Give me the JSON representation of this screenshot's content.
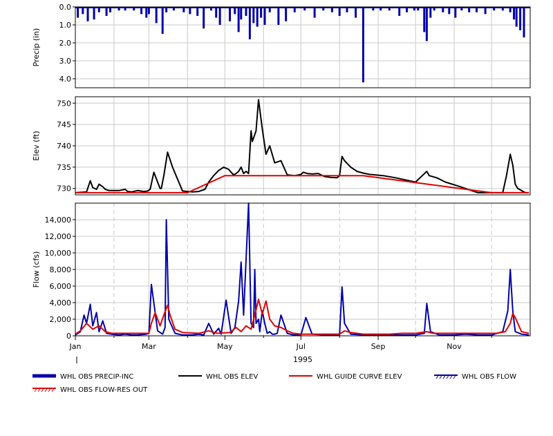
{
  "chart_data": [
    {
      "type": "bar",
      "ylabel": "Precip (in)",
      "ylim": [
        0,
        4.5
      ],
      "inverted": true,
      "yticks": [
        "0.0",
        "1.0",
        "2.0",
        "3.0",
        "4.0"
      ],
      "series": [
        {
          "name": "WHL OBS PRECIP-INC",
          "color": "#0000a8",
          "x": [
            "Jan 3",
            "Jan 7",
            "Jan 11",
            "Jan 16",
            "Jan 20",
            "Jan 26",
            "Jan 29",
            "Feb 5",
            "Feb 10",
            "Feb 17",
            "Feb 23",
            "Feb 27",
            "Mar 1",
            "Mar 7",
            "Mar 12",
            "Mar 15",
            "Mar 21",
            "Mar 29",
            "Apr 3",
            "Apr 9",
            "Apr 14",
            "Apr 20",
            "Apr 24",
            "Apr 27",
            "May 5",
            "May 9",
            "May 12",
            "May 14",
            "May 18",
            "May 21",
            "May 24",
            "May 27",
            "May 30",
            "Jun 2",
            "Jun 6",
            "Jun 13",
            "Jun 19",
            "Jun 26",
            "Jul 4",
            "Jul 12",
            "Jul 19",
            "Jul 26",
            "Aug 1",
            "Aug 7",
            "Aug 14",
            "Aug 20",
            "Aug 28",
            "Sep 3",
            "Sep 10",
            "Sep 18",
            "Sep 24",
            "Sep 30",
            "Oct 3",
            "Oct 8",
            "Oct 10",
            "Oct 13",
            "Oct 16",
            "Oct 23",
            "Oct 28",
            "Nov 2",
            "Nov 7",
            "Nov 13",
            "Nov 19",
            "Nov 26",
            "Dec 3",
            "Dec 10",
            "Dec 16",
            "Dec 19",
            "Dec 21",
            "Dec 24",
            "Dec 27"
          ],
          "values": [
            0.6,
            0.4,
            0.8,
            0.7,
            0.3,
            0.5,
            0.3,
            0.2,
            0.2,
            0.2,
            0.4,
            0.6,
            0.4,
            0.9,
            1.5,
            0.3,
            0.2,
            0.3,
            0.4,
            0.5,
            1.2,
            0.2,
            0.6,
            1.0,
            0.8,
            0.4,
            1.4,
            0.7,
            0.5,
            1.8,
            0.9,
            1.1,
            0.6,
            1.0,
            0.3,
            1.0,
            0.8,
            0.3,
            0.2,
            0.6,
            0.2,
            0.3,
            0.5,
            0.3,
            0.6,
            4.2,
            0.2,
            0.2,
            0.2,
            0.5,
            0.3,
            0.2,
            0.2,
            1.4,
            1.9,
            0.6,
            0.2,
            0.3,
            0.4,
            0.6,
            0.2,
            0.3,
            0.3,
            0.4,
            0.2,
            0.2,
            0.3,
            0.7,
            1.1,
            1.3,
            1.7
          ]
        }
      ]
    },
    {
      "type": "line",
      "ylabel": "Elev (ft)",
      "ylim": [
        728.5,
        751.5
      ],
      "yticks": [
        "730",
        "735",
        "740",
        "745",
        "750"
      ],
      "series": [
        {
          "name": "WHL OBS ELEV",
          "color": "#000000",
          "x": [
            "Jan 1",
            "Jan 10",
            "Jan 13",
            "Jan 15",
            "Jan 18",
            "Jan 20",
            "Jan 23",
            "Jan 25",
            "Jan 28",
            "Feb 5",
            "Feb 10",
            "Feb 12",
            "Feb 15",
            "Feb 20",
            "Feb 25",
            "Feb 28",
            "Mar 2",
            "Mar 5",
            "Mar 8",
            "Mar 10",
            "Mar 11",
            "Mar 13",
            "Mar 16",
            "Mar 20",
            "Mar 28",
            "Apr 5",
            "Apr 10",
            "Apr 15",
            "Apr 18",
            "Apr 22",
            "Apr 26",
            "Apr 30",
            "May 4",
            "May 6",
            "May 8",
            "May 10",
            "May 12",
            "May 14",
            "May 16",
            "May 18",
            "May 20",
            "May 22",
            "May 23",
            "May 26",
            "May 28",
            "May 31",
            "Jun 3",
            "Jun 6",
            "Jun 10",
            "Jun 15",
            "Jun 20",
            "Jun 26",
            "Jul 1",
            "Jul 3",
            "Jul 6",
            "Jul 10",
            "Jul 15",
            "Jul 20",
            "Jul 25",
            "Jul 30",
            "Aug 1",
            "Aug 3",
            "Aug 5",
            "Aug 10",
            "Aug 15",
            "Aug 20",
            "Aug 25",
            "Sep 5",
            "Sep 15",
            "Oct 1",
            "Oct 10",
            "Oct 12",
            "Oct 18",
            "Oct 25",
            "Nov 5",
            "Nov 15",
            "Nov 20",
            "Dec 1",
            "Dec 10",
            "Dec 13",
            "Dec 16",
            "Dec 18",
            "Dec 20",
            "Dec 22",
            "Dec 25",
            "Dec 28",
            "Dec 31"
          ],
          "values": [
            729,
            729.2,
            731.8,
            730.2,
            729.8,
            731.0,
            730.4,
            729.8,
            729.5,
            729.5,
            729.8,
            729.3,
            729.2,
            729.5,
            729.3,
            729.4,
            729.8,
            733.8,
            731.5,
            730.0,
            730.0,
            733.0,
            738.5,
            735.0,
            729.4,
            729.2,
            729.3,
            729.8,
            731.5,
            733.0,
            734.2,
            735.0,
            734.5,
            733.8,
            733.2,
            733.5,
            734.0,
            735.0,
            733.5,
            734.0,
            733.5,
            743.5,
            741.0,
            743.5,
            750.8,
            744.0,
            738.0,
            740.0,
            736.0,
            736.5,
            733.2,
            733.0,
            733.3,
            733.8,
            733.5,
            733.4,
            733.5,
            732.8,
            732.6,
            732.5,
            733.0,
            737.5,
            736.5,
            735.0,
            734.0,
            733.6,
            733.3,
            733.0,
            732.5,
            731.5,
            734.0,
            733.0,
            732.5,
            731.5,
            730.5,
            729.5,
            729.0,
            729.0,
            729.0,
            733.0,
            738.0,
            735.5,
            731.0,
            730.0,
            729.5,
            729.0,
            729.0
          ]
        },
        {
          "name": "WHL GUIDE CURVE ELEV",
          "color": "#e00000",
          "x": [
            "Jan 1",
            "Apr 1",
            "May 1",
            "Aug 20",
            "Dec 1",
            "Dec 31"
          ],
          "values": [
            729,
            729,
            733,
            733,
            729,
            729
          ]
        }
      ]
    },
    {
      "type": "line",
      "ylabel": "Flow (cfs)",
      "xlabel": "1995",
      "ylim": [
        0,
        16000
      ],
      "yticks": [
        "0",
        "2,000",
        "4,000",
        "6,000",
        "8,000",
        "10,000",
        "12,000",
        "14,000"
      ],
      "xticks": [
        "Jan",
        "Mar",
        "May",
        "Jul",
        "Sep",
        "Nov"
      ],
      "series": [
        {
          "name": "WHL OBS FLOW",
          "color": "#0000a8",
          "x": [
            "Jan 1",
            "Jan 5",
            "Jan 8",
            "Jan 10",
            "Jan 13",
            "Jan 15",
            "Jan 18",
            "Jan 20",
            "Jan 23",
            "Jan 26",
            "Jan 30",
            "Feb 5",
            "Feb 10",
            "Feb 15",
            "Feb 20",
            "Feb 27",
            "Mar 1",
            "Mar 3",
            "Mar 8",
            "Mar 12",
            "Mar 14",
            "Mar 15",
            "Mar 17",
            "Mar 22",
            "Mar 28",
            "Apr 5",
            "Apr 10",
            "Apr 14",
            "Apr 18",
            "Apr 22",
            "Apr 26",
            "Apr 28",
            "May 2",
            "May 6",
            "May 9",
            "May 12",
            "May 14",
            "May 16",
            "May 20",
            "May 22",
            "May 24",
            "May 25",
            "May 26",
            "May 28",
            "May 29",
            "May 31",
            "Jun 2",
            "Jun 4",
            "Jun 6",
            "Jun 8",
            "Jun 10",
            "Jun 12",
            "Jun 15",
            "Jun 20",
            "Jun 25",
            "Jul 1",
            "Jul 5",
            "Jul 10",
            "Jul 20",
            "Jul 28",
            "Aug 1",
            "Aug 3",
            "Aug 5",
            "Aug 10",
            "Aug 20",
            "Sep 1",
            "Sep 15",
            "Oct 1",
            "Oct 8",
            "Oct 10",
            "Oct 13",
            "Oct 20",
            "Nov 1",
            "Nov 10",
            "Nov 20",
            "Dec 1",
            "Dec 10",
            "Dec 14",
            "Dec 16",
            "Dec 18",
            "Dec 20",
            "Dec 25",
            "Dec 31"
          ],
          "values": [
            100,
            500,
            2500,
            1500,
            3800,
            1200,
            2800,
            500,
            1800,
            300,
            200,
            100,
            200,
            100,
            100,
            200,
            300,
            6200,
            600,
            200,
            1000,
            14000,
            2000,
            300,
            100,
            100,
            200,
            100,
            1500,
            200,
            900,
            200,
            4300,
            300,
            1000,
            4200,
            8900,
            2500,
            16000,
            1500,
            1000,
            8000,
            1500,
            2000,
            500,
            3000,
            1500,
            300,
            500,
            200,
            200,
            300,
            2500,
            300,
            100,
            100,
            2200,
            200,
            100,
            100,
            100,
            5900,
            1500,
            200,
            100,
            100,
            100,
            100,
            300,
            3900,
            500,
            100,
            100,
            200,
            100,
            100,
            500,
            3000,
            8000,
            3000,
            500,
            200,
            100
          ]
        },
        {
          "name": "WHL OBS FLOW-RES OUT",
          "color": "#e00000",
          "x": [
            "Jan 1",
            "Jan 5",
            "Jan 10",
            "Jan 15",
            "Jan 20",
            "Jan 25",
            "Jan 30",
            "Feb 10",
            "Feb 20",
            "Mar 1",
            "Mar 3",
            "Mar 6",
            "Mar 10",
            "Mar 13",
            "Mar 16",
            "Mar 18",
            "Mar 22",
            "Mar 28",
            "Apr 10",
            "Apr 18",
            "Apr 25",
            "May 5",
            "May 10",
            "May 14",
            "May 18",
            "May 22",
            "May 25",
            "May 28",
            "May 31",
            "Jun 3",
            "Jun 6",
            "Jun 10",
            "Jun 15",
            "Jun 20",
            "Jun 25",
            "Jul 1",
            "Jul 10",
            "Jul 20",
            "Aug 1",
            "Aug 5",
            "Aug 10",
            "Aug 20",
            "Sep 1",
            "Sep 10",
            "Sep 20",
            "Oct 1",
            "Oct 10",
            "Oct 15",
            "Oct 25",
            "Nov 5",
            "Nov 15",
            "Nov 25",
            "Dec 5",
            "Dec 12",
            "Dec 16",
            "Dec 18",
            "Dec 20",
            "Dec 25",
            "Dec 31"
          ],
          "values": [
            200,
            600,
            1500,
            800,
            1200,
            500,
            300,
            300,
            300,
            300,
            1500,
            2800,
            1200,
            2500,
            3700,
            2500,
            800,
            400,
            300,
            600,
            300,
            400,
            1000,
            500,
            1200,
            800,
            2500,
            4400,
            2600,
            4200,
            2000,
            1200,
            1000,
            600,
            300,
            200,
            200,
            200,
            200,
            600,
            400,
            200,
            200,
            200,
            300,
            300,
            500,
            300,
            300,
            300,
            300,
            300,
            300,
            500,
            1500,
            2700,
            2200,
            500,
            300
          ]
        }
      ]
    }
  ],
  "legend": {
    "items": [
      {
        "label": "WHL OBS PRECIP-INC",
        "color": "#0000a8",
        "style": "thick"
      },
      {
        "label": "WHL OBS ELEV",
        "color": "#000000",
        "style": "line"
      },
      {
        "label": "WHL GUIDE CURVE ELEV",
        "color": "#e00000",
        "style": "line"
      },
      {
        "label": "WHL OBS FLOW",
        "color": "#0000a8",
        "style": "hatched"
      },
      {
        "label": "WHL OBS FLOW-RES OUT",
        "color": "#e00000",
        "style": "hatched"
      }
    ]
  }
}
